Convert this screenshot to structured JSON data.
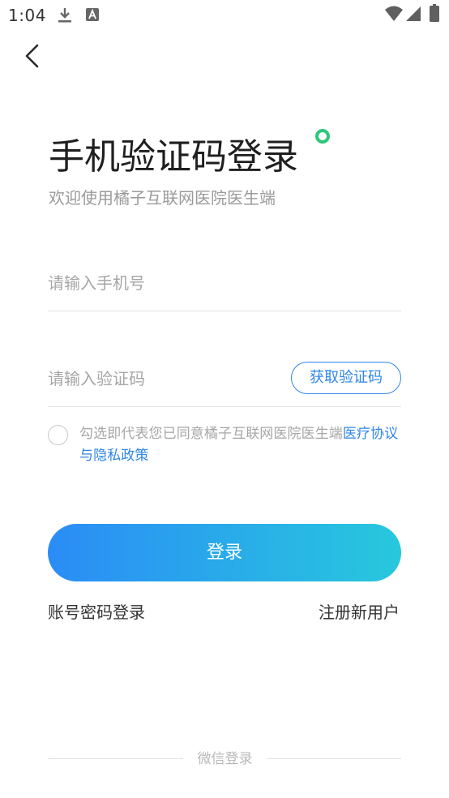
{
  "status_bar": {
    "time": "1:04",
    "icons": [
      "download-icon",
      "a-notification-icon",
      "wifi-icon",
      "signal-icon",
      "battery-icon"
    ]
  },
  "nav": {
    "back_icon": "chevron-left-icon"
  },
  "header": {
    "title": "手机验证码登录",
    "subtitle": "欢迎使用橘子互联网医院医生端"
  },
  "form": {
    "phone_placeholder": "请输入手机号",
    "phone_value": "",
    "code_placeholder": "请输入验证码",
    "code_value": "",
    "get_code_label": "获取验证码"
  },
  "agreement": {
    "checked": false,
    "text": "勾选即代表您已同意橘子互联网医院医生端",
    "link_text": "医疗协议与隐私政策"
  },
  "actions": {
    "login_label": "登录",
    "account_login_label": "账号密码登录",
    "register_label": "注册新用户"
  },
  "footer": {
    "wechat_login_label": "微信登录"
  },
  "colors": {
    "accent_blue": "#2f86e8",
    "gradient_start": "#2a8cf6",
    "gradient_end": "#28c8dd",
    "title_dot_green": "#2dc77a"
  }
}
